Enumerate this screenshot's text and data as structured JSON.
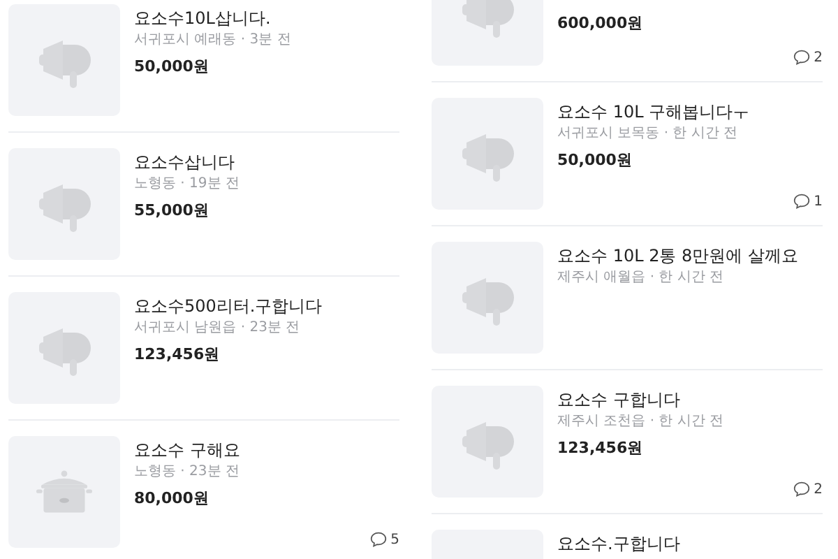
{
  "columns": [
    {
      "items": [
        {
          "title": "요소수10L삽니다.",
          "meta": "서귀포시 예래동 · 3분 전",
          "price": "50,000원",
          "kind": "megaphone"
        },
        {
          "title": "요소수삽니다",
          "meta": "노형동 · 19분 전",
          "price": "55,000원",
          "kind": "megaphone"
        },
        {
          "title": "요소수500리터.구합니다",
          "meta": "서귀포시 남원읍 · 23분 전",
          "price": "123,456원",
          "kind": "megaphone"
        },
        {
          "title": "요소수 구해요",
          "meta": "노형동 · 23분 전",
          "price": "80,000원",
          "kind": "cooker",
          "comments": "5"
        }
      ]
    },
    {
      "items": [
        {
          "price": "600,000원",
          "kind": "megaphone",
          "comments": "2"
        },
        {
          "title": "요소수 10L 구해봅니다ㅜ",
          "meta": "서귀포시 보목동 · 한 시간 전",
          "price": "50,000원",
          "kind": "megaphone",
          "comments": "1"
        },
        {
          "title": "요소수 10L 2통 8만원에 살께요",
          "meta": "제주시 애월읍 · 한 시간 전",
          "kind": "megaphone"
        },
        {
          "title": "요소수 구합니다",
          "meta": "제주시 조천읍 · 한 시간 전",
          "price": "123,456원",
          "kind": "megaphone",
          "comments": "2"
        },
        {
          "title": "요소수.구합니다"
        }
      ]
    }
  ]
}
